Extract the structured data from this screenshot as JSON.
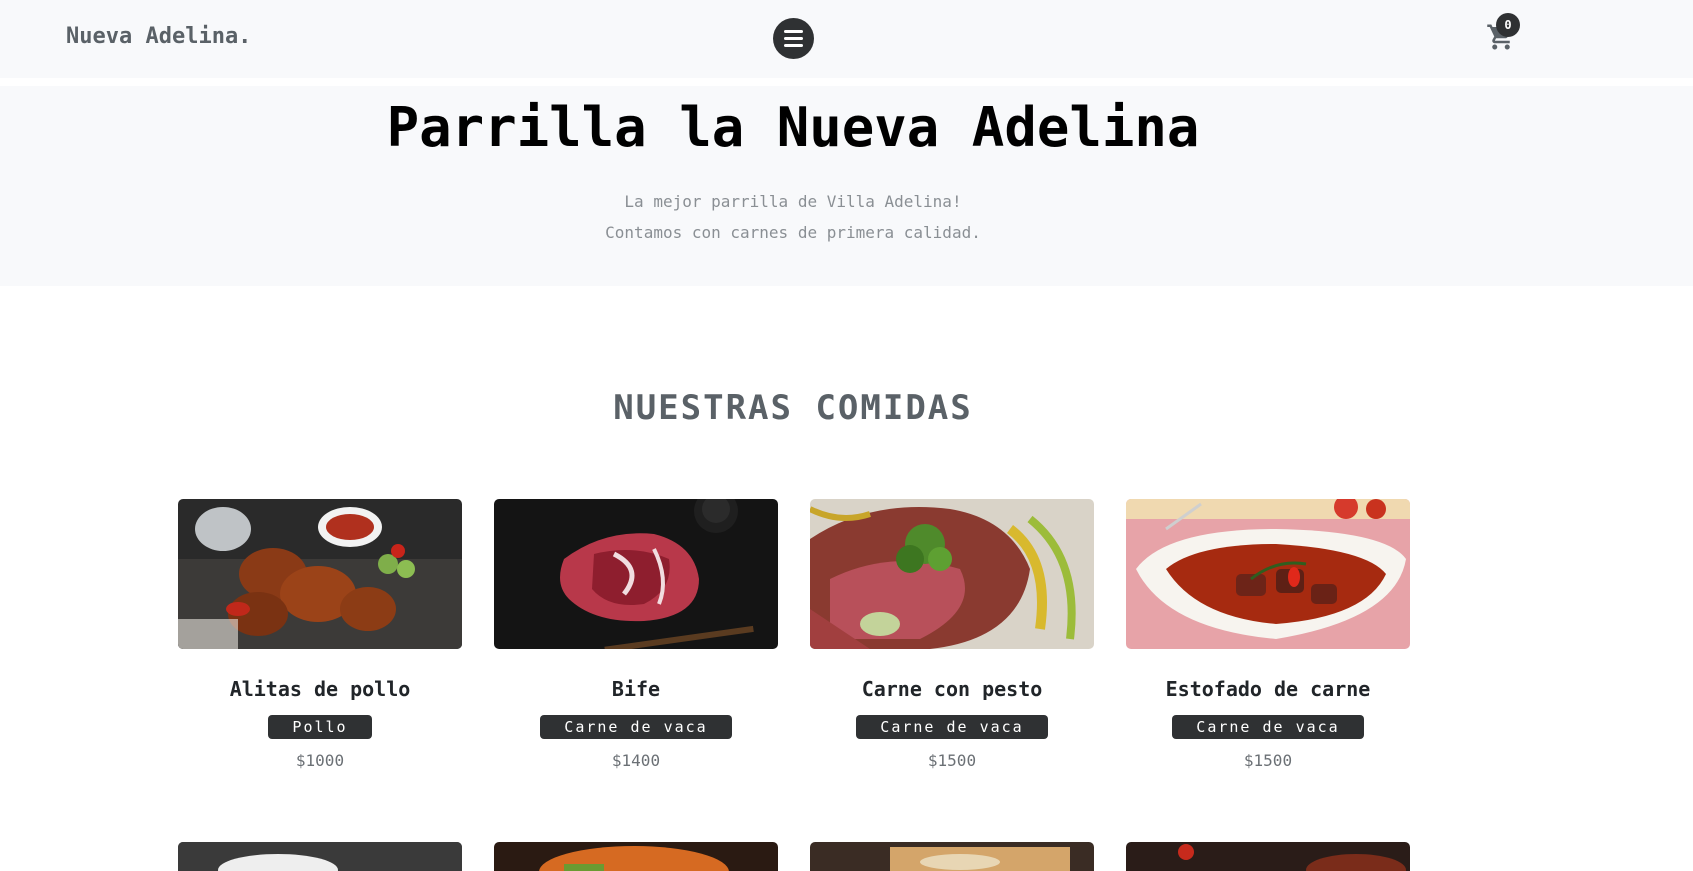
{
  "navbar": {
    "brand": "Nueva Adelina.",
    "cart_count": "0"
  },
  "hero": {
    "title": "Parrilla la Nueva Adelina",
    "line1": "La mejor parrilla de Villa Adelina!",
    "line2": "Contamos con carnes de primera calidad."
  },
  "section": {
    "title": "NUESTRAS COMIDAS"
  },
  "products": [
    {
      "name": "Alitas de pollo",
      "category": "Pollo",
      "price": "$1000",
      "image": "chicken-wings-photo"
    },
    {
      "name": "Bife",
      "category": "Carne de vaca",
      "price": "$1400",
      "image": "raw-steak-photo"
    },
    {
      "name": "Carne con pesto",
      "category": "Carne de vaca",
      "price": "$1500",
      "image": "steak-pesto-photo"
    },
    {
      "name": "Estofado de carne",
      "category": "Carne de vaca",
      "price": "$1500",
      "image": "beef-stew-photo"
    }
  ],
  "icons": {
    "menu": "hamburger-menu-icon",
    "cart": "shopping-cart-icon"
  },
  "colors": {
    "accent": "#2f3133",
    "header_bg": "#f8f9fb"
  }
}
